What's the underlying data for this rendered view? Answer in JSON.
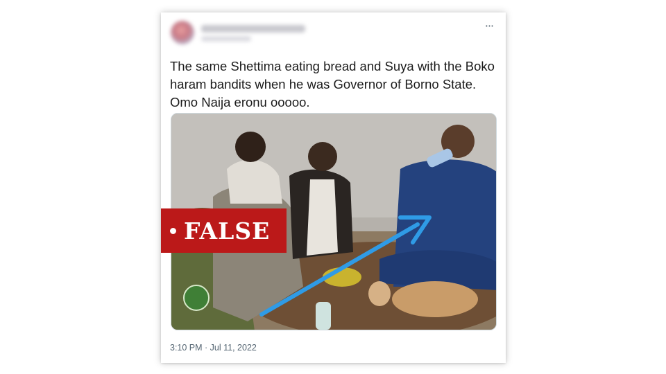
{
  "tweet": {
    "text": "The same Shettima eating bread and Suya with the Boko haram bandits when he was Governor of Borno State. Omo Naija eronu ooooo.",
    "timestamp": "3:10 PM · Jul 11, 2022",
    "more_icon": "more-options-icon",
    "more_label": "···"
  },
  "badge": {
    "label": "FALSE",
    "color": "#bb1919"
  },
  "annotation": {
    "arrow_color": "#2f9be6"
  }
}
